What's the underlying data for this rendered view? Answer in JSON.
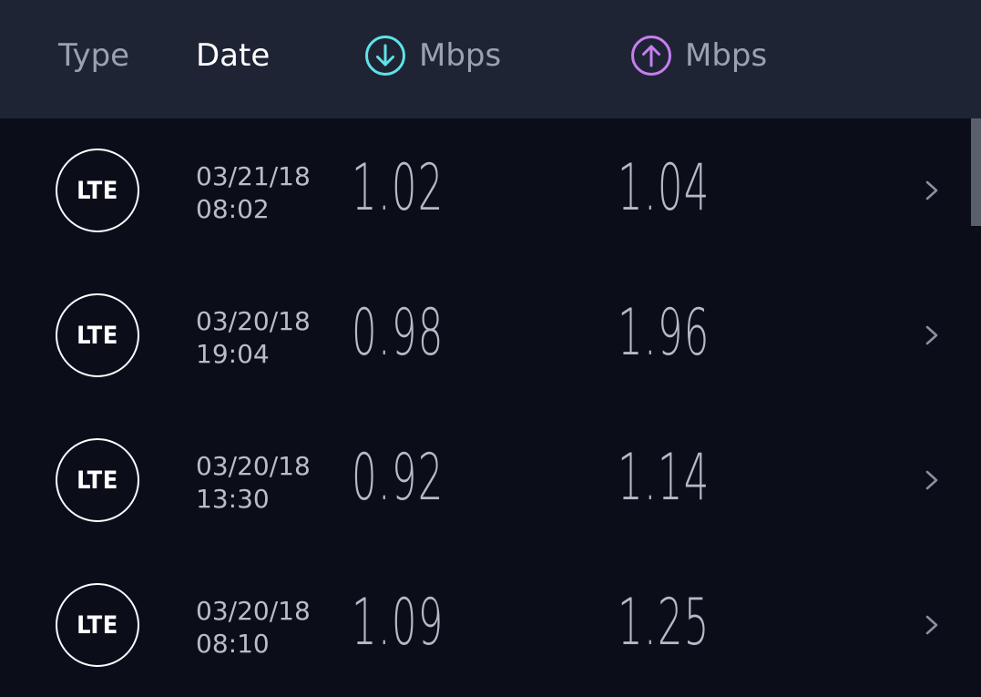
{
  "header": {
    "type_label": "Type",
    "date_label": "Date",
    "download_label": "Mbps",
    "upload_label": "Mbps",
    "download_icon": "arrow-down-circle-icon",
    "upload_icon": "arrow-up-circle-icon",
    "download_color": "#5fe3e6",
    "upload_color": "#c77ef0"
  },
  "results": [
    {
      "type": "LTE",
      "date": "03/21/18",
      "time": "08:02",
      "download": "1.02",
      "upload": "1.04"
    },
    {
      "type": "LTE",
      "date": "03/20/18",
      "time": "19:04",
      "download": "0.98",
      "upload": "1.96"
    },
    {
      "type": "LTE",
      "date": "03/20/18",
      "time": "13:30",
      "download": "0.92",
      "upload": "1.14"
    },
    {
      "type": "LTE",
      "date": "03/20/18",
      "time": "08:10",
      "download": "1.09",
      "upload": "1.25"
    }
  ],
  "colors": {
    "background": "#0b0e19",
    "header_background": "#1f2435",
    "text_primary": "#ffffff",
    "text_secondary": "#9ba1b0"
  }
}
